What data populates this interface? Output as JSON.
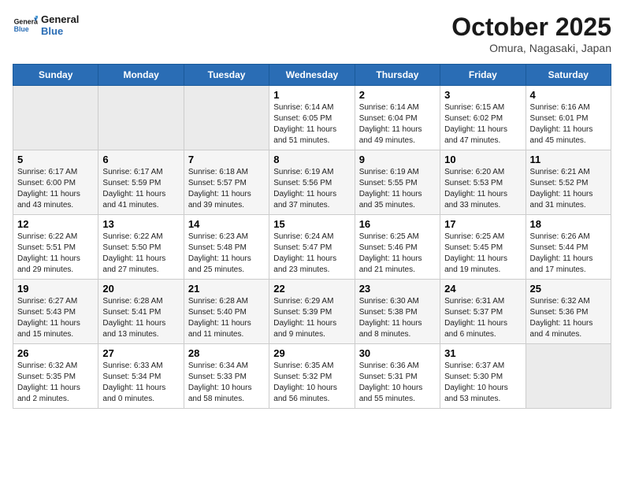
{
  "header": {
    "logo_line1": "General",
    "logo_line2": "Blue",
    "title": "October 2025",
    "subtitle": "Omura, Nagasaki, Japan"
  },
  "days_of_week": [
    "Sunday",
    "Monday",
    "Tuesday",
    "Wednesday",
    "Thursday",
    "Friday",
    "Saturday"
  ],
  "weeks": [
    [
      {
        "date": "",
        "empty": true
      },
      {
        "date": "",
        "empty": true
      },
      {
        "date": "",
        "empty": true
      },
      {
        "date": "1",
        "sunrise": "6:14 AM",
        "sunset": "6:05 PM",
        "daylight": "11 hours and 51 minutes."
      },
      {
        "date": "2",
        "sunrise": "6:14 AM",
        "sunset": "6:04 PM",
        "daylight": "11 hours and 49 minutes."
      },
      {
        "date": "3",
        "sunrise": "6:15 AM",
        "sunset": "6:02 PM",
        "daylight": "11 hours and 47 minutes."
      },
      {
        "date": "4",
        "sunrise": "6:16 AM",
        "sunset": "6:01 PM",
        "daylight": "11 hours and 45 minutes."
      }
    ],
    [
      {
        "date": "5",
        "sunrise": "6:17 AM",
        "sunset": "6:00 PM",
        "daylight": "11 hours and 43 minutes."
      },
      {
        "date": "6",
        "sunrise": "6:17 AM",
        "sunset": "5:59 PM",
        "daylight": "11 hours and 41 minutes."
      },
      {
        "date": "7",
        "sunrise": "6:18 AM",
        "sunset": "5:57 PM",
        "daylight": "11 hours and 39 minutes."
      },
      {
        "date": "8",
        "sunrise": "6:19 AM",
        "sunset": "5:56 PM",
        "daylight": "11 hours and 37 minutes."
      },
      {
        "date": "9",
        "sunrise": "6:19 AM",
        "sunset": "5:55 PM",
        "daylight": "11 hours and 35 minutes."
      },
      {
        "date": "10",
        "sunrise": "6:20 AM",
        "sunset": "5:53 PM",
        "daylight": "11 hours and 33 minutes."
      },
      {
        "date": "11",
        "sunrise": "6:21 AM",
        "sunset": "5:52 PM",
        "daylight": "11 hours and 31 minutes."
      }
    ],
    [
      {
        "date": "12",
        "sunrise": "6:22 AM",
        "sunset": "5:51 PM",
        "daylight": "11 hours and 29 minutes."
      },
      {
        "date": "13",
        "sunrise": "6:22 AM",
        "sunset": "5:50 PM",
        "daylight": "11 hours and 27 minutes."
      },
      {
        "date": "14",
        "sunrise": "6:23 AM",
        "sunset": "5:48 PM",
        "daylight": "11 hours and 25 minutes."
      },
      {
        "date": "15",
        "sunrise": "6:24 AM",
        "sunset": "5:47 PM",
        "daylight": "11 hours and 23 minutes."
      },
      {
        "date": "16",
        "sunrise": "6:25 AM",
        "sunset": "5:46 PM",
        "daylight": "11 hours and 21 minutes."
      },
      {
        "date": "17",
        "sunrise": "6:25 AM",
        "sunset": "5:45 PM",
        "daylight": "11 hours and 19 minutes."
      },
      {
        "date": "18",
        "sunrise": "6:26 AM",
        "sunset": "5:44 PM",
        "daylight": "11 hours and 17 minutes."
      }
    ],
    [
      {
        "date": "19",
        "sunrise": "6:27 AM",
        "sunset": "5:43 PM",
        "daylight": "11 hours and 15 minutes."
      },
      {
        "date": "20",
        "sunrise": "6:28 AM",
        "sunset": "5:41 PM",
        "daylight": "11 hours and 13 minutes."
      },
      {
        "date": "21",
        "sunrise": "6:28 AM",
        "sunset": "5:40 PM",
        "daylight": "11 hours and 11 minutes."
      },
      {
        "date": "22",
        "sunrise": "6:29 AM",
        "sunset": "5:39 PM",
        "daylight": "11 hours and 9 minutes."
      },
      {
        "date": "23",
        "sunrise": "6:30 AM",
        "sunset": "5:38 PM",
        "daylight": "11 hours and 8 minutes."
      },
      {
        "date": "24",
        "sunrise": "6:31 AM",
        "sunset": "5:37 PM",
        "daylight": "11 hours and 6 minutes."
      },
      {
        "date": "25",
        "sunrise": "6:32 AM",
        "sunset": "5:36 PM",
        "daylight": "11 hours and 4 minutes."
      }
    ],
    [
      {
        "date": "26",
        "sunrise": "6:32 AM",
        "sunset": "5:35 PM",
        "daylight": "11 hours and 2 minutes."
      },
      {
        "date": "27",
        "sunrise": "6:33 AM",
        "sunset": "5:34 PM",
        "daylight": "11 hours and 0 minutes."
      },
      {
        "date": "28",
        "sunrise": "6:34 AM",
        "sunset": "5:33 PM",
        "daylight": "10 hours and 58 minutes."
      },
      {
        "date": "29",
        "sunrise": "6:35 AM",
        "sunset": "5:32 PM",
        "daylight": "10 hours and 56 minutes."
      },
      {
        "date": "30",
        "sunrise": "6:36 AM",
        "sunset": "5:31 PM",
        "daylight": "10 hours and 55 minutes."
      },
      {
        "date": "31",
        "sunrise": "6:37 AM",
        "sunset": "5:30 PM",
        "daylight": "10 hours and 53 minutes."
      },
      {
        "date": "",
        "empty": true
      }
    ]
  ],
  "labels": {
    "sunrise_prefix": "Sunrise: ",
    "sunset_prefix": "Sunset: ",
    "daylight_prefix": "Daylight: "
  }
}
